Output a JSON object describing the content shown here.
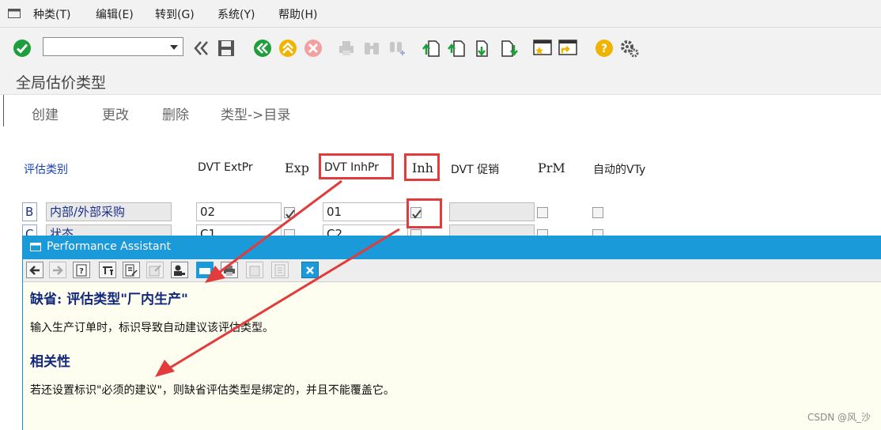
{
  "menu": {
    "items": [
      "种类(T)",
      "编辑(E)",
      "转到(G)",
      "系统(Y)",
      "帮助(H)"
    ]
  },
  "toolbar": {
    "command_field_value": "",
    "icons": [
      "check-icon",
      "rewind-icon",
      "save-icon",
      "back-icon",
      "exit-icon",
      "cancel-icon",
      "print-icon",
      "find-icon",
      "find-next-icon",
      "first-page-icon",
      "prev-page-icon",
      "next-page-icon",
      "last-page-icon",
      "new-session-icon",
      "shortcut-icon",
      "help-icon",
      "settings-icon"
    ]
  },
  "page": {
    "title": "全局估价类型"
  },
  "app_toolbar": {
    "create": "创建",
    "change": "更改",
    "delete": "删除",
    "type_dir": "类型->目录"
  },
  "table": {
    "headers": {
      "category": "评估类别",
      "ext_pr": "DVT ExtPr",
      "exp": "Exp",
      "inh_pr": "DVT InhPr",
      "inh": "Inh",
      "promo": "DVT 促销",
      "prm": "PrM",
      "auto": "自动的VTy"
    },
    "rows": [
      {
        "key": "B",
        "desc": "内部/外部采购",
        "ext_pr": "02",
        "exp": true,
        "inh_pr": "01",
        "inh": true,
        "promo": "",
        "prm": false,
        "auto": false
      },
      {
        "key": "C",
        "desc": "状态",
        "ext_pr": "C1",
        "exp": false,
        "inh_pr": "C2",
        "inh": false,
        "promo": "",
        "prm": false,
        "auto": false
      }
    ]
  },
  "assistant": {
    "title": "Performance Assistant",
    "heading1": "缺省: 评估类型\"厂内生产\"",
    "para1": "输入生产订单时，标识导致自动建议该评估类型。",
    "heading2": "相关性",
    "para2": "若还设置标识\"必须的建议\"，则缺省评估类型是绑定的，并且不能覆盖它。"
  },
  "watermark": "CSDN @风_沙",
  "colors": {
    "accent_blue": "#1b9ad9",
    "highlight_red": "#e23b3b",
    "ok_green": "#1f9e3c"
  }
}
